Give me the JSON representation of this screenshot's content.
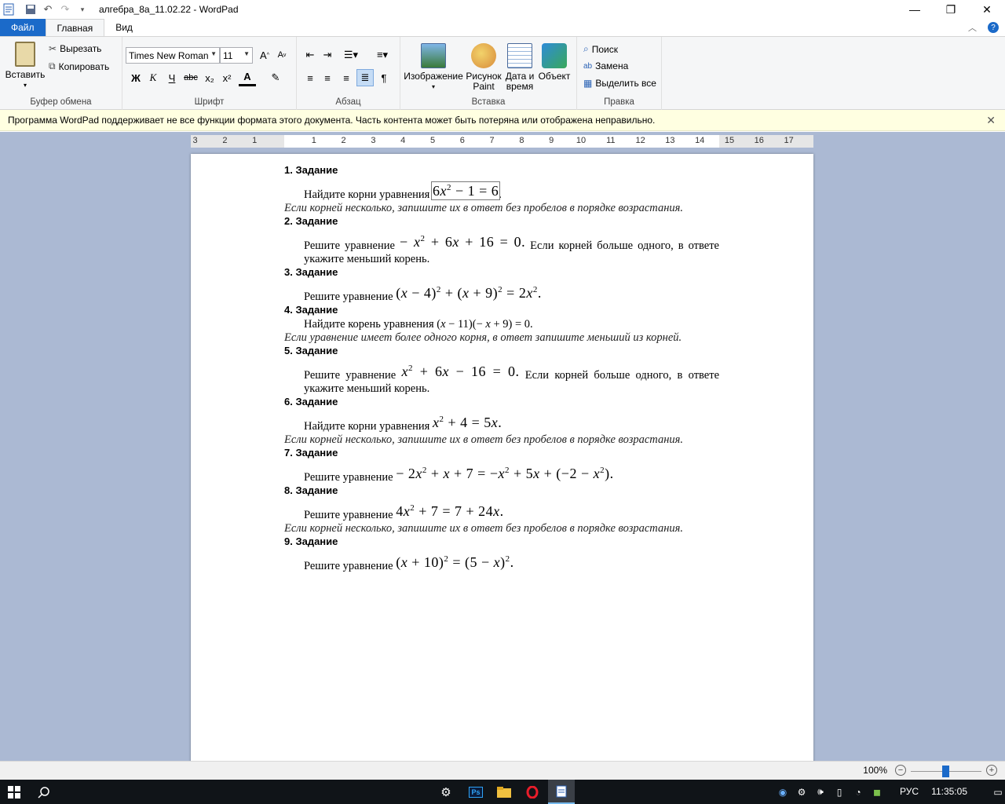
{
  "window": {
    "title": "алгебра_8а_11.02.22 - WordPad",
    "minimize_icon": "minimize-icon",
    "maximize_icon": "restore-icon",
    "close_icon": "close-icon"
  },
  "ribbon": {
    "tabs": [
      "Файл",
      "Главная",
      "Вид"
    ],
    "clipboard": {
      "label": "Буфер обмена",
      "paste": "Вставить",
      "cut": "Вырезать",
      "copy": "Копировать"
    },
    "font": {
      "label": "Шрифт",
      "family": "Times New Roman",
      "size": "11",
      "bold": "Ж",
      "italic": "К",
      "underline": "Ч",
      "strike": "abc",
      "sub": "x₂",
      "sup": "x²",
      "color": "A"
    },
    "paragraph": {
      "label": "Абзац"
    },
    "insert": {
      "label": "Вставка",
      "image": "Изображение",
      "paint1": "Рисунок",
      "paint2": "Paint",
      "date1": "Дата и",
      "date2": "время",
      "object": "Объект"
    },
    "edit": {
      "label": "Правка",
      "find": "Поиск",
      "replace": "Замена",
      "select_all": "Выделить все"
    }
  },
  "infobar": {
    "text": "Программа WordPad поддерживает не все функции формата этого документа. Часть контента может быть потеряна или отображена неправильно."
  },
  "ruler": {
    "labels": [
      "3",
      "2",
      "1",
      "1",
      "2",
      "3",
      "4",
      "5",
      "6",
      "7",
      "8",
      "9",
      "10",
      "11",
      "12",
      "13",
      "14",
      "15",
      "16",
      "17"
    ]
  },
  "document": {
    "tasks": [
      {
        "title": "1. Задание",
        "lead": "Найдите корни уравнения",
        "note": "Если корней несколько, запишите их в ответ без пробелов в порядке возрастания."
      },
      {
        "title": "2. Задание",
        "lead": "Решите уравнение",
        "tail": "Если корней больше одного, в ответе укажите меньший корень."
      },
      {
        "title": "3. Задание",
        "lead": "Решите уравнение"
      },
      {
        "title": "4. Задание",
        "lead": "Найдите корень уравнения",
        "note": "Если уравнение имеет более одного корня, в ответ запишите меньший из корней."
      },
      {
        "title": "5. Задание",
        "lead": "Решите уравнение",
        "tail": "Если корней больше одного, в ответе укажите меньший корень."
      },
      {
        "title": "6. Задание",
        "lead": "Найдите корни уравнения",
        "note": "Если корней несколько, запишите их в ответ без пробелов в порядке возрастания."
      },
      {
        "title": "7. Задание",
        "lead": "Решите уравнение"
      },
      {
        "title": "8. Задание",
        "lead": "Решите уравнение",
        "note": "Если корней несколько, запишите их в ответ без пробелов в порядке возрастания."
      },
      {
        "title": "9. Задание",
        "lead": "Решите уравнение"
      }
    ]
  },
  "status": {
    "zoom": "100%"
  },
  "taskbar": {
    "lang": "РУС",
    "time": "11:35:05"
  }
}
